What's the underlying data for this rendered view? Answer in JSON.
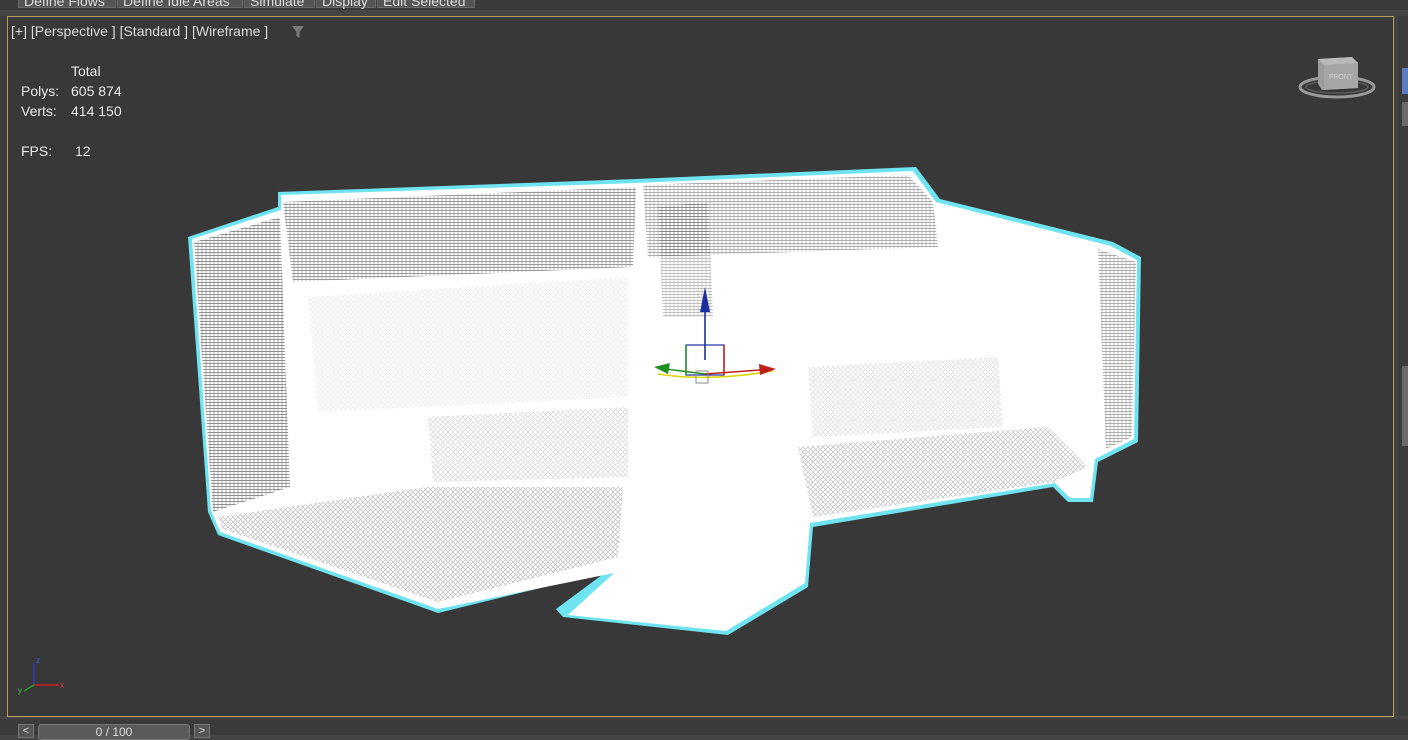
{
  "ribbon": {
    "tabs": [
      "Define Flows",
      "Define Idle Areas",
      "Simulate",
      "Display",
      "Edit Selected"
    ]
  },
  "viewport": {
    "label_plus": "[+]",
    "label_view": "[Perspective ]",
    "label_shading": "[Standard ]",
    "label_mode": "[Wireframe ]"
  },
  "stats": {
    "header": "Total",
    "polys_label": "Polys:",
    "polys_value": "605 874",
    "verts_label": "Verts:",
    "verts_value": "414 150",
    "fps_label": "FPS:",
    "fps_value": "12"
  },
  "viewcube": {
    "face_label": "FRONT"
  },
  "timeline": {
    "prev_label": "<",
    "next_label": ">",
    "frame_display": "0 / 100"
  },
  "colors": {
    "viewport_bg": "#383838",
    "active_border": "#b5a05a",
    "selection_outline": "#6fe3f0",
    "wireframe": "#ffffff",
    "gizmo_x": "#c0201a",
    "gizmo_y": "#1e8f1e",
    "gizmo_z": "#1a2fa0"
  }
}
